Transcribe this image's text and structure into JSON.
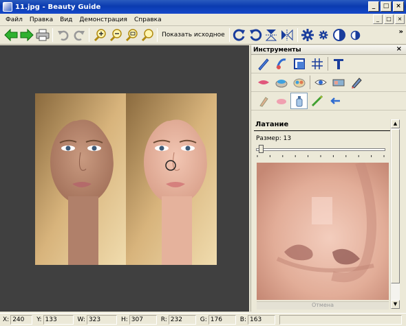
{
  "window": {
    "title": "11.jpg - Beauty Guide",
    "buttons": [
      "_",
      "□",
      "×"
    ]
  },
  "menu": {
    "items": [
      "Файл",
      "Правка",
      "Вид",
      "Демонстрация",
      "Справка"
    ],
    "right_controls": [
      "_",
      "□",
      "×"
    ]
  },
  "toolbar": {
    "show_original_label": "Показать исходное",
    "overflow": "»",
    "icons": [
      "arrow-left-green-icon",
      "arrow-right-green-icon",
      "print-icon",
      "undo-icon",
      "redo-icon",
      "zoom-in-icon",
      "zoom-out-icon",
      "zoom-fit-icon",
      "zoom-actual-icon",
      "rotate-cw-icon",
      "rotate-ccw-icon",
      "flip-vertical-icon",
      "flip-horizontal-icon",
      "gear-large-icon",
      "gear-small-icon",
      "contrast-large-icon",
      "contrast-small-icon"
    ]
  },
  "tools_panel": {
    "title": "Инструменты",
    "close": "×",
    "active_tool": "Латание",
    "size_label": "Размер: 13",
    "size_value": 13,
    "size_fraction": 0.02,
    "zoom_caption": "Отмена",
    "row1": [
      "brush-icon",
      "healing-icon",
      "crop-icon",
      "grid-icon",
      "text-icon"
    ],
    "row2": [
      "lips-icon",
      "foundation-icon",
      "eyeshadow-icon",
      "eye-icon",
      "blush-palette-icon",
      "pencil-icon"
    ],
    "row3": [
      "lip-liner-icon",
      "lip-gloss-icon",
      "bottle-icon",
      "hair-color-icon",
      "smudge-icon"
    ]
  },
  "status": {
    "x_label": "X:",
    "x_value": "240",
    "y_label": "Y:",
    "y_value": "133",
    "w_label": "W:",
    "w_value": "323",
    "h_label": "H:",
    "h_value": "307",
    "r_label": "R:",
    "r_value": "232",
    "g_label": "G:",
    "g_value": "176",
    "b_label": "B:",
    "b_value": "163"
  },
  "colors": {
    "titlebar": "#0a3bb0",
    "canvas_bg": "#404040",
    "panel_bg": "#ece9d8",
    "skin": "#e8b9a6"
  }
}
